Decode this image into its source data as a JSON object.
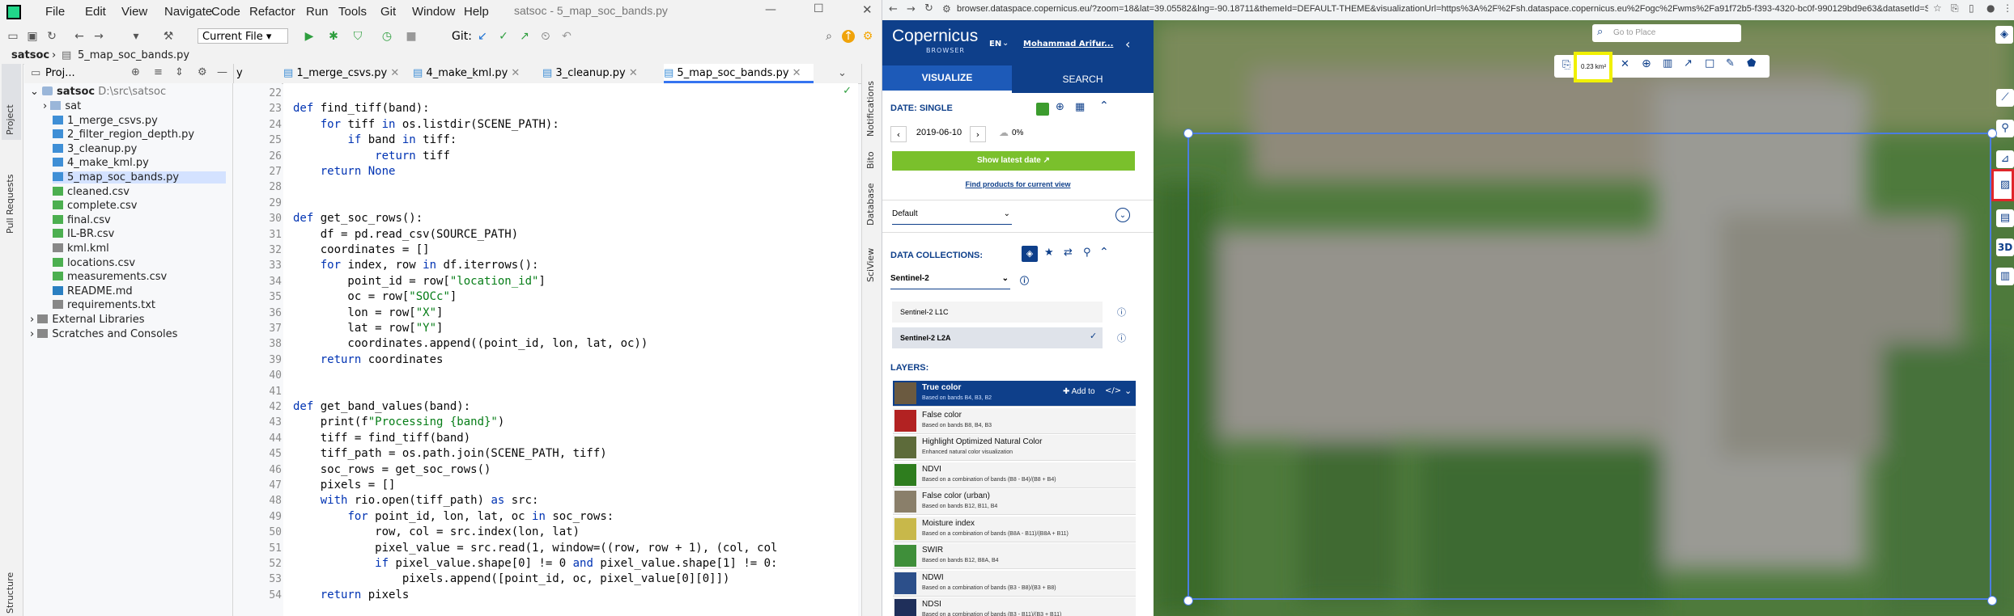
{
  "ide": {
    "menu": [
      "File",
      "Edit",
      "View",
      "Navigate",
      "Code",
      "Refactor",
      "Run",
      "Tools",
      "Git",
      "Window",
      "Help"
    ],
    "title": "satsoc - 5_map_soc_bands.py",
    "toolbar": {
      "current_file": "Current File",
      "git_label": "Git:"
    },
    "breadcrumb": {
      "project": "satsoc",
      "file": "5_map_soc_bands.py"
    },
    "project_label": "Proj...",
    "tabs": [
      "y",
      "1_merge_csvs.py",
      "4_make_kml.py",
      "3_cleanup.py",
      "5_map_soc_bands.py"
    ],
    "side_labels": {
      "project": "Project",
      "pull": "Pull Requests",
      "structure": "Structure",
      "notifications": "Notifications",
      "bito": "Bito",
      "database": "Database",
      "sciview": "SciView"
    },
    "tree": {
      "root": "satsoc",
      "root_path": "D:\\src\\satsoc",
      "items": [
        "sat",
        "1_merge_csvs.py",
        "2_filter_region_depth.py",
        "3_cleanup.py",
        "4_make_kml.py",
        "5_map_soc_bands.py",
        "cleaned.csv",
        "complete.csv",
        "final.csv",
        "IL-BR.csv",
        "kml.kml",
        "locations.csv",
        "measurements.csv",
        "README.md",
        "requirements.txt",
        "External Libraries",
        "Scratches and Consoles"
      ]
    },
    "line_numbers": [
      "22",
      "23",
      "24",
      "25",
      "26",
      "27",
      "28",
      "29",
      "30",
      "31",
      "32",
      "33",
      "34",
      "35",
      "36",
      "37",
      "38",
      "39",
      "40",
      "41",
      "42",
      "43",
      "44",
      "45",
      "46",
      "47",
      "48",
      "49",
      "50",
      "51",
      "52",
      "53",
      "54"
    ],
    "code": [
      "",
      "def find_tiff(band):",
      "    for tiff in os.listdir(SCENE_PATH):",
      "        if band in tiff:",
      "            return tiff",
      "    return None",
      "",
      "",
      "def get_soc_rows():",
      "    df = pd.read_csv(SOURCE_PATH)",
      "    coordinates = []",
      "    for index, row in df.iterrows():",
      "        point_id = row[\"location_id\"]",
      "        oc = row[\"SOCc\"]",
      "        lon = row[\"X\"]",
      "        lat = row[\"Y\"]",
      "        coordinates.append((point_id, lon, lat, oc))",
      "    return coordinates",
      "",
      "",
      "def get_band_values(band):",
      "    print(f\"Processing {band}\")",
      "    tiff = find_tiff(band)",
      "    tiff_path = os.path.join(SCENE_PATH, tiff)",
      "    soc_rows = get_soc_rows()",
      "    pixels = []",
      "    with rio.open(tiff_path) as src:",
      "        for point_id, lon, lat, oc in soc_rows:",
      "            row, col = src.index(lon, lat)",
      "            pixel_value = src.read(1, window=((row, row + 1), (col, col",
      "            if pixel_value.shape[0] != 0 and pixel_value.shape[1] != 0:",
      "                pixels.append([point_id, oc, pixel_value[0][0]])",
      "    return pixels"
    ]
  },
  "browser": {
    "url": "browser.dataspace.copernicus.eu/?zoom=18&lat=39.05582&lng=-90.18711&themeId=DEFAULT-THEME&visualizationUrl=https%3A%2F%2Fsh.dataspace.copernicus.eu%2Fogc%2Fwms%2Fa91f72b5-f393-4320-bc0f-990129bd9e63&datasetId=S2_L2A...",
    "logo": "Copernicus",
    "logo_sub": "BROWSER",
    "lang": "EN",
    "user": "Mohammad Arifur...",
    "tab_visualize": "VISUALIZE",
    "tab_search": "SEARCH",
    "date_label": "DATE: SINGLE",
    "date_value": "2019-06-10",
    "cloud": "0%",
    "show_latest": "Show latest date",
    "find_products": "Find products for current view",
    "theme": "Default",
    "data_collections": "DATA COLLECTIONS:",
    "collection": "Sentinel-2",
    "collection_items": [
      "Sentinel-2 L1C",
      "Sentinel-2 L2A"
    ],
    "layers_label": "LAYERS:",
    "add_to": "Add to",
    "layers": [
      {
        "name": "True color",
        "desc": "Based on bands B4, B3, B2",
        "color": "#6b5a40"
      },
      {
        "name": "False color",
        "desc": "Based on bands B8, B4, B3",
        "color": "#b22222"
      },
      {
        "name": "Highlight Optimized Natural Color",
        "desc": "Enhanced natural color visualization",
        "color": "#5d6b3a"
      },
      {
        "name": "NDVI",
        "desc": "Based on a combination of bands (B8 - B4)/(B8 + B4)",
        "color": "#2e7d1e"
      },
      {
        "name": "False color (urban)",
        "desc": "Based on bands B12, B11, B4",
        "color": "#8a7f6a"
      },
      {
        "name": "Moisture index",
        "desc": "Based on a combination of bands (B8A - B11)/(B8A + B11)",
        "color": "#c8b84a"
      },
      {
        "name": "SWIR",
        "desc": "Based on bands B12, B8A, B4",
        "color": "#3f8f3a"
      },
      {
        "name": "NDWI",
        "desc": "Based on a combination of bands (B3 - B8)/(B3 + B8)",
        "color": "#2c4f8a"
      },
      {
        "name": "NDSI",
        "desc": "Based on a combination of bands (B3 - B11)/(B3 + B11)",
        "color": "#1f2f5a"
      }
    ],
    "search_place": "Go to Place",
    "area": "0.23 km²",
    "map_tools": [
      "copy-icon",
      "close-icon",
      "target-icon",
      "chart-icon",
      "graph-icon",
      "square-icon",
      "pencil-icon",
      "pentagon-icon"
    ],
    "side_tools": [
      "line-icon",
      "pin-icon",
      "ruler-icon",
      "image-download-icon",
      "film-icon",
      "3D",
      "histogram-icon"
    ],
    "label_3d": "3D"
  }
}
